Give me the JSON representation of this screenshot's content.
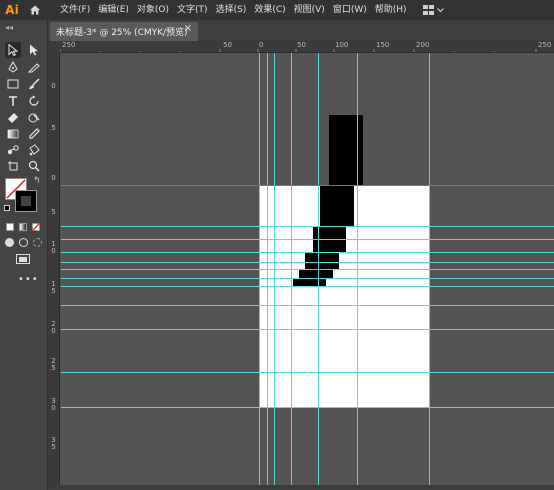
{
  "app": {
    "logo": "Ai"
  },
  "menu": [
    "文件(F)",
    "编辑(E)",
    "对象(O)",
    "文字(T)",
    "选择(S)",
    "效果(C)",
    "视图(V)",
    "窗口(W)",
    "帮助(H)"
  ],
  "tab": {
    "title": "未标题-3* @ 25% (CMYK/预览)",
    "close": "×"
  },
  "ruler_top": [
    "250",
    "50",
    "0",
    "50",
    "100",
    "150",
    "200",
    "250"
  ],
  "ruler_left": [
    "0",
    "5",
    "0",
    "5",
    "1 0",
    "1 5",
    "2 0",
    "2 5",
    "3 0",
    "3 5"
  ],
  "colors": {
    "guide": "#4ddcd8",
    "artboard_top_guide": "#4a7fd6",
    "shape_fill": "#000000"
  },
  "icons": {
    "home": "home-icon",
    "workspace": "workspace-icon",
    "chevron": "chevron-down-icon",
    "selection": "selection-icon",
    "direct": "direct-selection-icon",
    "pen": "pen-icon",
    "pencil": "curvature-icon",
    "rect": "rectangle-icon",
    "brush": "paintbrush-icon",
    "type": "type-icon",
    "rotate": "rotate-icon",
    "eraser": "eraser-icon",
    "shaper": "shaper-icon",
    "gradient": "gradient-icon",
    "eyedropper": "eyedropper-icon",
    "blend": "blend-icon",
    "livepaint": "live-paint-icon",
    "artboard": "artboard-icon",
    "zoom": "zoom-icon"
  }
}
